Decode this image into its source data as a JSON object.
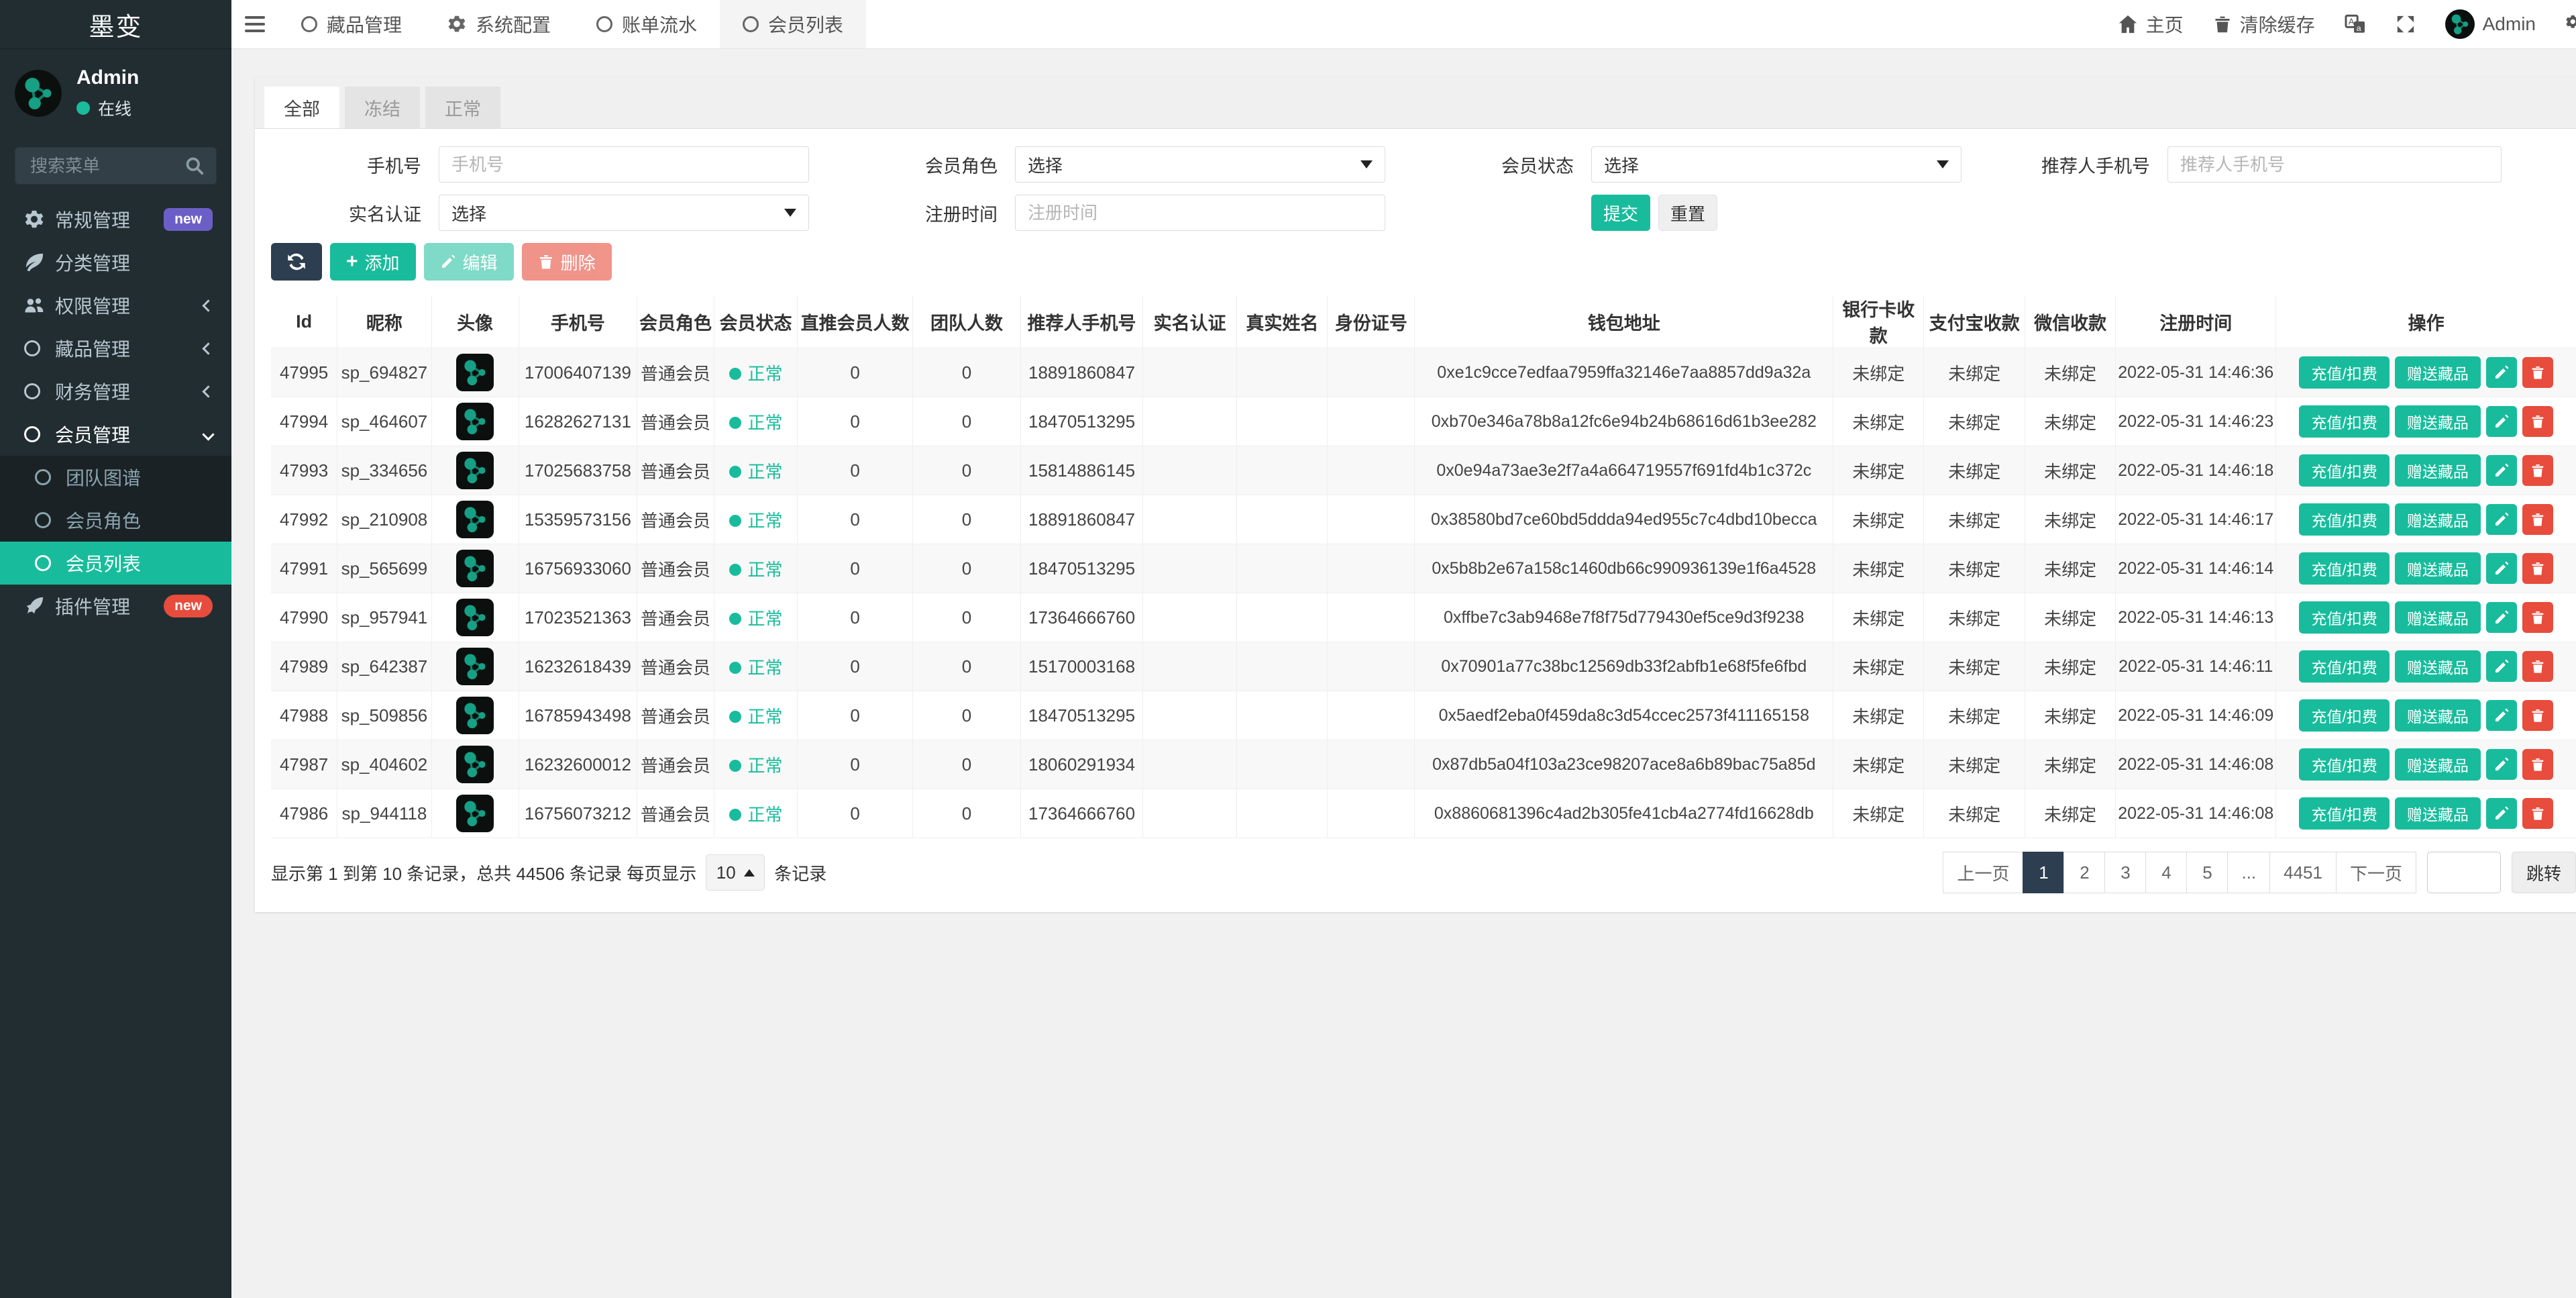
{
  "brand": {
    "logo": "墨变"
  },
  "user_panel": {
    "name": "Admin",
    "status": "在线"
  },
  "sidebar": {
    "search_placeholder": "搜索菜单",
    "items": [
      {
        "label": "常规管理",
        "badge": "new",
        "badge_color": "#6c5ec7"
      },
      {
        "label": "分类管理"
      },
      {
        "label": "权限管理"
      },
      {
        "label": "藏品管理"
      },
      {
        "label": "财务管理"
      },
      {
        "label": "会员管理"
      },
      {
        "label": "团队图谱"
      },
      {
        "label": "会员角色"
      },
      {
        "label": "会员列表"
      },
      {
        "label": "插件管理",
        "badge": "new",
        "badge_color": "#e74c3c"
      }
    ]
  },
  "topnav": {
    "tabs": [
      {
        "label": "藏品管理"
      },
      {
        "label": "系统配置"
      },
      {
        "label": "账单流水"
      },
      {
        "label": "会员列表"
      }
    ],
    "home": "主页",
    "clear_cache": "清除缓存",
    "username": "Admin"
  },
  "view_tabs": [
    {
      "label": "全部"
    },
    {
      "label": "冻结"
    },
    {
      "label": "正常"
    }
  ],
  "filters": {
    "phone": {
      "label": "手机号",
      "placeholder": "手机号"
    },
    "member_role": {
      "label": "会员角色",
      "value": "选择"
    },
    "member_status": {
      "label": "会员状态",
      "value": "选择"
    },
    "referrer_phone": {
      "label": "推荐人手机号",
      "placeholder": "推荐人手机号"
    },
    "real_name_auth": {
      "label": "实名认证",
      "value": "选择"
    },
    "register_time": {
      "label": "注册时间",
      "placeholder": "注册时间"
    },
    "submit": "提交",
    "reset": "重置"
  },
  "toolbar": {
    "add": "添加",
    "edit": "编辑",
    "delete": "删除"
  },
  "table": {
    "headers": [
      "Id",
      "昵称",
      "头像",
      "手机号",
      "会员角色",
      "会员状态",
      "直推会员人数",
      "团队人数",
      "推荐人手机号",
      "实名认证",
      "真实姓名",
      "身份证号",
      "钱包地址",
      "银行卡收款",
      "支付宝收款",
      "微信收款",
      "注册时间",
      "操作"
    ],
    "action_labels": {
      "recharge": "充值/扣费",
      "gift": "赠送藏品"
    },
    "rows": [
      {
        "id": "47995",
        "nickname": "sp_694827",
        "phone": "17006407139",
        "role": "普通会员",
        "status": "正常",
        "direct": "0",
        "team": "0",
        "referrer": "18891860847",
        "realname": "",
        "truename": "",
        "idcard": "",
        "wallet": "0xe1c9cce7edfaa7959ffa32146e7aa8857dd9a32a",
        "bank": "未绑定",
        "alipay": "未绑定",
        "wechat": "未绑定",
        "time": "2022-05-31 14:46:36"
      },
      {
        "id": "47994",
        "nickname": "sp_464607",
        "phone": "16282627131",
        "role": "普通会员",
        "status": "正常",
        "direct": "0",
        "team": "0",
        "referrer": "18470513295",
        "realname": "",
        "truename": "",
        "idcard": "",
        "wallet": "0xb70e346a78b8a12fc6e94b24b68616d61b3ee282",
        "bank": "未绑定",
        "alipay": "未绑定",
        "wechat": "未绑定",
        "time": "2022-05-31 14:46:23"
      },
      {
        "id": "47993",
        "nickname": "sp_334656",
        "phone": "17025683758",
        "role": "普通会员",
        "status": "正常",
        "direct": "0",
        "team": "0",
        "referrer": "15814886145",
        "realname": "",
        "truename": "",
        "idcard": "",
        "wallet": "0x0e94a73ae3e2f7a4a664719557f691fd4b1c372c",
        "bank": "未绑定",
        "alipay": "未绑定",
        "wechat": "未绑定",
        "time": "2022-05-31 14:46:18"
      },
      {
        "id": "47992",
        "nickname": "sp_210908",
        "phone": "15359573156",
        "role": "普通会员",
        "status": "正常",
        "direct": "0",
        "team": "0",
        "referrer": "18891860847",
        "realname": "",
        "truename": "",
        "idcard": "",
        "wallet": "0x38580bd7ce60bd5ddda94ed955c7c4dbd10becca",
        "bank": "未绑定",
        "alipay": "未绑定",
        "wechat": "未绑定",
        "time": "2022-05-31 14:46:17"
      },
      {
        "id": "47991",
        "nickname": "sp_565699",
        "phone": "16756933060",
        "role": "普通会员",
        "status": "正常",
        "direct": "0",
        "team": "0",
        "referrer": "18470513295",
        "realname": "",
        "truename": "",
        "idcard": "",
        "wallet": "0x5b8b2e67a158c1460db66c990936139e1f6a4528",
        "bank": "未绑定",
        "alipay": "未绑定",
        "wechat": "未绑定",
        "time": "2022-05-31 14:46:14"
      },
      {
        "id": "47990",
        "nickname": "sp_957941",
        "phone": "17023521363",
        "role": "普通会员",
        "status": "正常",
        "direct": "0",
        "team": "0",
        "referrer": "17364666760",
        "realname": "",
        "truename": "",
        "idcard": "",
        "wallet": "0xffbe7c3ab9468e7f8f75d779430ef5ce9d3f9238",
        "bank": "未绑定",
        "alipay": "未绑定",
        "wechat": "未绑定",
        "time": "2022-05-31 14:46:13"
      },
      {
        "id": "47989",
        "nickname": "sp_642387",
        "phone": "16232618439",
        "role": "普通会员",
        "status": "正常",
        "direct": "0",
        "team": "0",
        "referrer": "15170003168",
        "realname": "",
        "truename": "",
        "idcard": "",
        "wallet": "0x70901a77c38bc12569db33f2abfb1e68f5fe6fbd",
        "bank": "未绑定",
        "alipay": "未绑定",
        "wechat": "未绑定",
        "time": "2022-05-31 14:46:11"
      },
      {
        "id": "47988",
        "nickname": "sp_509856",
        "phone": "16785943498",
        "role": "普通会员",
        "status": "正常",
        "direct": "0",
        "team": "0",
        "referrer": "18470513295",
        "realname": "",
        "truename": "",
        "idcard": "",
        "wallet": "0x5aedf2eba0f459da8c3d54ccec2573f411165158",
        "bank": "未绑定",
        "alipay": "未绑定",
        "wechat": "未绑定",
        "time": "2022-05-31 14:46:09"
      },
      {
        "id": "47987",
        "nickname": "sp_404602",
        "phone": "16232600012",
        "role": "普通会员",
        "status": "正常",
        "direct": "0",
        "team": "0",
        "referrer": "18060291934",
        "realname": "",
        "truename": "",
        "idcard": "",
        "wallet": "0x87db5a04f103a23ce98207ace8a6b89bac75a85d",
        "bank": "未绑定",
        "alipay": "未绑定",
        "wechat": "未绑定",
        "time": "2022-05-31 14:46:08"
      },
      {
        "id": "47986",
        "nickname": "sp_944118",
        "phone": "16756073212",
        "role": "普通会员",
        "status": "正常",
        "direct": "0",
        "team": "0",
        "referrer": "17364666760",
        "realname": "",
        "truename": "",
        "idcard": "",
        "wallet": "0x8860681396c4ad2b305fe41cb4a2774fd16628db",
        "bank": "未绑定",
        "alipay": "未绑定",
        "wechat": "未绑定",
        "time": "2022-05-31 14:46:08"
      }
    ]
  },
  "footer": {
    "info_prefix": "显示第 1 到第 10 条记录，总共 44506 条记录 每页显示",
    "page_size": "10",
    "info_suffix": "条记录",
    "pagination": [
      "上一页",
      "1",
      "2",
      "3",
      "4",
      "5",
      "...",
      "4451",
      "下一页"
    ],
    "active_page": "1",
    "jump": "跳转"
  },
  "colors": {
    "accent": "#18bc9c",
    "dark": "#2c3e50",
    "danger": "#e74c3c",
    "sidebar": "#222d32"
  }
}
